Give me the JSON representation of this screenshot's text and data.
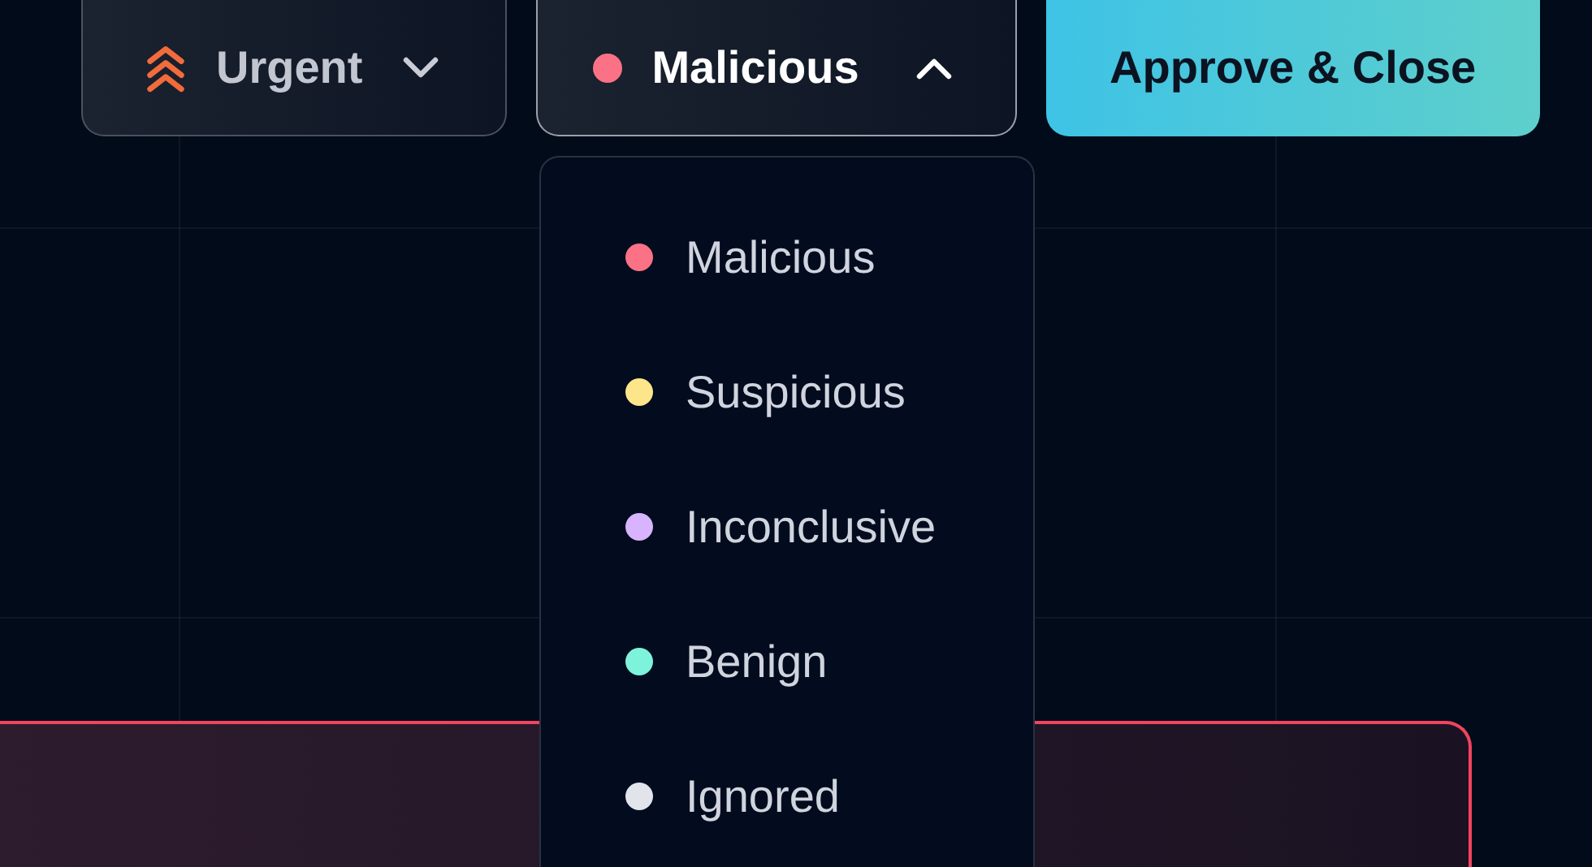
{
  "priority": {
    "label": "Urgent",
    "expanded": false
  },
  "verdict": {
    "label": "Malicious",
    "color": "#fb7185",
    "expanded": true
  },
  "verdict_menu": [
    {
      "label": "Malicious",
      "color": "#fb7185"
    },
    {
      "label": "Suspicious",
      "color": "#fde68a"
    },
    {
      "label": "Inconclusive",
      "color": "#d8b4fe"
    },
    {
      "label": "Benign",
      "color": "#7ef3dc"
    },
    {
      "label": "Ignored",
      "color": "#e2e4ec"
    }
  ],
  "approve_button": {
    "label": "Approve & Close"
  }
}
